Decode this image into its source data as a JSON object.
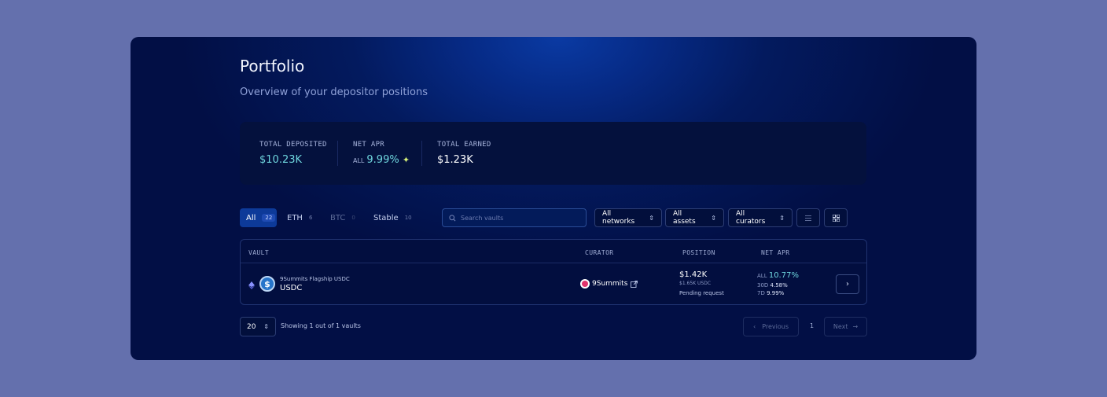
{
  "page": {
    "title": "Portfolio",
    "subtitle": "Overview of your depositor positions"
  },
  "stats": {
    "total_deposited": {
      "label": "TOTAL DEPOSITED",
      "value": "$10.23K"
    },
    "net_apr": {
      "label": "NET APR",
      "prefix": "ALL",
      "value": "9.99%",
      "icon": "sparkle-icon"
    },
    "total_earned": {
      "label": "TOTAL EARNED",
      "value": "$1.23K"
    }
  },
  "tabs": [
    {
      "label": "All",
      "count": "22",
      "active": true
    },
    {
      "label": "ETH",
      "count": "6"
    },
    {
      "label": "BTC",
      "count": "0",
      "disabled": true
    },
    {
      "label": "Stable",
      "count": "10"
    }
  ],
  "search": {
    "placeholder": "Search vaults"
  },
  "filters": {
    "networks": "All networks",
    "assets": "All assets",
    "curators": "All curators"
  },
  "table": {
    "headers": {
      "vault": "VAULT",
      "curator": "CURATOR",
      "position": "POSITION",
      "net_apr": "NET APR"
    },
    "rows": [
      {
        "vault_name": "9Summits Flagship USDC",
        "asset": "USDC",
        "curator": "9Summits",
        "position_value": "$1.42K",
        "position_sub": "$1.65K USDC",
        "position_status": "Pending request",
        "apr": {
          "all_label": "ALL",
          "all": "10.77%",
          "d30_label": "30D",
          "d30": "4.58%",
          "d7_label": "7D",
          "d7": "9.99%"
        }
      }
    ]
  },
  "pagination": {
    "page_size": "20",
    "showing": "Showing 1 out of 1 vaults",
    "previous": "Previous",
    "next": "Next",
    "current_page": "1"
  },
  "colors": {
    "accent": "#6fd6de",
    "background": "#6470ad",
    "panel": "#020f45",
    "active_tab": "#0d3a99"
  }
}
